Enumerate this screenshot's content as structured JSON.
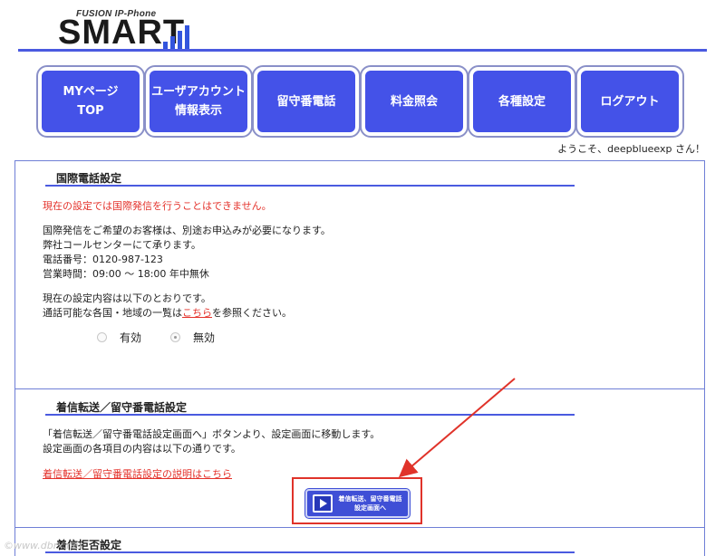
{
  "logo": {
    "subtitle": "FUSION IP-Phone",
    "title": "SMART"
  },
  "nav": [
    {
      "label": "MYページ\nTOP"
    },
    {
      "label": "ユーザアカウント\n情報表示"
    },
    {
      "label": "留守番電話"
    },
    {
      "label": "料金照会"
    },
    {
      "label": "各種設定"
    },
    {
      "label": "ログアウト"
    }
  ],
  "welcome": "ようこそ、deepblueexp さん！",
  "international": {
    "title": "国際電話設定",
    "warning": "現在の設定では国際発信を行うことはできません。",
    "info_lines": [
      "国際発信をご希望のお客様は、別途お申込みが必要になります。",
      "弊社コールセンターにて承ります。",
      "電話番号：0120-987-123",
      "営業時間：09:00 〜 18:00 年中無休"
    ],
    "current_line": "現在の設定内容は以下のとおりです。",
    "countries_prefix": "通話可能な各国・地域の一覧は",
    "countries_link": "こちら",
    "countries_suffix": "を参照ください。",
    "radio_on": "有効",
    "radio_off": "無効",
    "selected": "無効"
  },
  "forwarding": {
    "title": "着信転送／留守番電話設定",
    "line1": "「着信転送／留守番電話設定画面へ」ボタンより、設定画面に移動します。",
    "line2": "設定画面の各項目の内容は以下の通りです。",
    "help_link": "着信転送／留守番電話設定の説明はこちら",
    "button_label": "着信転送、留守番電話\n設定画面へ"
  },
  "rejection": {
    "title": "着信拒否設定"
  },
  "watermark": "©www.dbrx.net",
  "colors": {
    "nav_bg": "#4452e8",
    "accent": "#4a5ae0",
    "warning": "#e4322b",
    "highlight": "#e0332a"
  }
}
